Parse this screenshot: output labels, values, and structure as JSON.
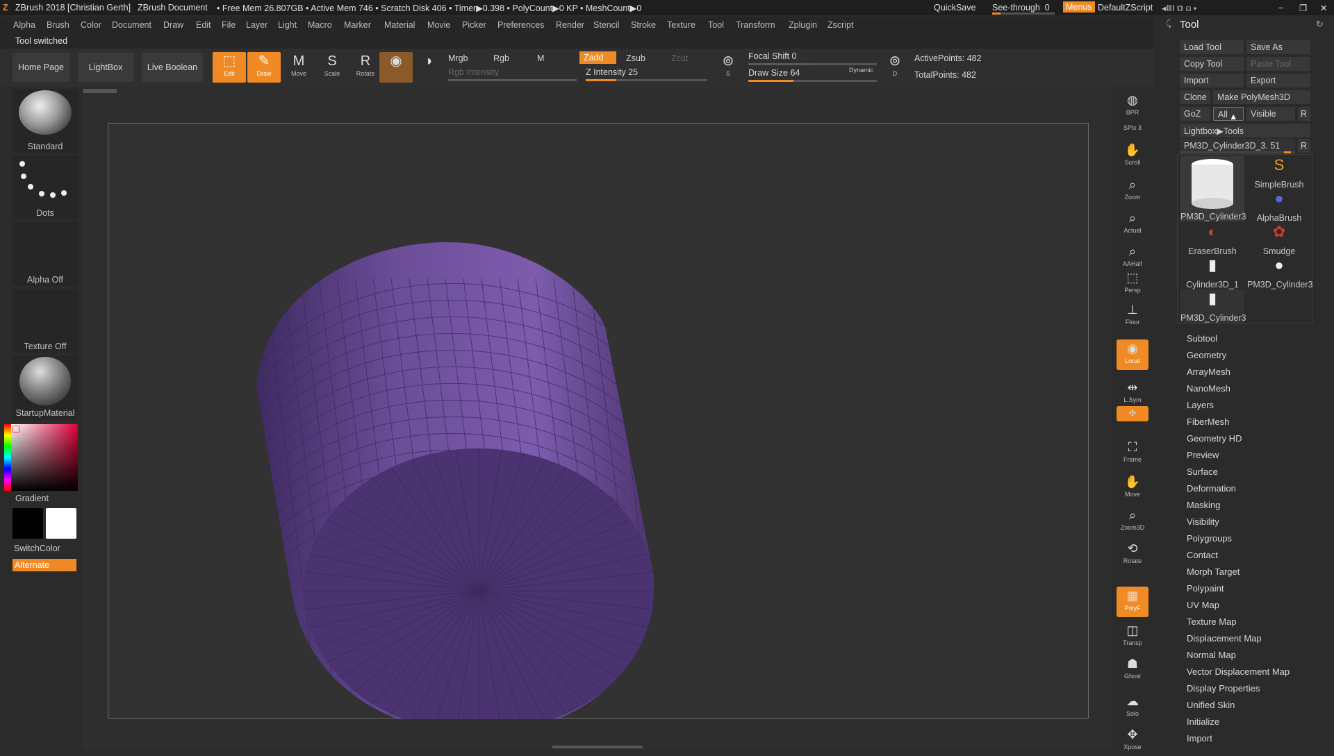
{
  "titlebar": {
    "app": "ZBrush 2018 [Christian Gerth]",
    "document": "ZBrush Document",
    "stats": "• Free Mem 26.807GB • Active Mem 746 • Scratch Disk 406 • Timer▶0.398 • PolyCount▶0 KP • MeshCount▶0",
    "quicksave": "QuickSave",
    "see_through": "See-through",
    "see_through_value": "0",
    "menus": "Menus",
    "script": "DefaultZScript"
  },
  "menubar": [
    "Alpha",
    "Brush",
    "Color",
    "Document",
    "Draw",
    "Edit",
    "File",
    "Layer",
    "Light",
    "Macro",
    "Marker",
    "Material",
    "Movie",
    "Picker",
    "Preferences",
    "Render",
    "Stencil",
    "Stroke",
    "Texture",
    "Tool",
    "Transform",
    "Zplugin",
    "Zscript"
  ],
  "status_text": "Tool switched",
  "toolbar": {
    "home_page": "Home Page",
    "lightbox": "LightBox",
    "live_boolean": "Live Boolean",
    "edit": "Edit",
    "draw": "Draw",
    "move": "Move",
    "scale": "Scale",
    "rotate": "Rotate",
    "mrgb": "Mrgb",
    "rgb": "Rgb",
    "m": "M",
    "zadd": "Zadd",
    "zsub": "Zsub",
    "zcut": "Zcut",
    "rgb_intensity": "Rgb Intensity",
    "z_intensity_label": "Z Intensity",
    "z_intensity": 25,
    "focal_shift_label": "Focal Shift",
    "focal_shift": 0,
    "draw_size_label": "Draw Size",
    "draw_size": 64,
    "dynamic": "Dynamic",
    "active_points": "ActivePoints: 482",
    "total_points": "TotalPoints: 482"
  },
  "left_shelf": {
    "brush": "Standard",
    "stroke": "Dots",
    "alpha": "Alpha Off",
    "texture": "Texture Off",
    "material": "StartupMaterial",
    "gradient": "Gradient",
    "switch_color": "SwitchColor",
    "alternate": "Alternate"
  },
  "right_shelf": [
    {
      "name": "bpr",
      "label": "BPR",
      "icon": "bpr-icon",
      "on": false
    },
    {
      "name": "spix",
      "label": "SPix 3",
      "icon": "",
      "on": false
    },
    {
      "name": "scroll",
      "label": "Scroll",
      "icon": "hand-icon",
      "on": false
    },
    {
      "name": "zoom",
      "label": "Zoom",
      "icon": "zoom-icon",
      "on": false
    },
    {
      "name": "actual",
      "label": "Actual",
      "icon": "zoom-icon",
      "on": false
    },
    {
      "name": "aahalf",
      "label": "AAHalf",
      "icon": "zoom-icon",
      "on": false
    },
    {
      "name": "persp",
      "label": "Persp",
      "icon": "persp-icon",
      "on": false
    },
    {
      "name": "floor",
      "label": "Floor",
      "icon": "floor-icon",
      "on": false
    },
    {
      "name": "local",
      "label": "Local",
      "icon": "local-icon",
      "on": true
    },
    {
      "name": "lsym",
      "label": "L.Sym",
      "icon": "sym-icon",
      "on": false
    },
    {
      "name": "xyz",
      "label": "xyz",
      "icon": "xyz-icon",
      "on": true
    },
    {
      "name": "frame",
      "label": "Frame",
      "icon": "frame-icon",
      "on": false
    },
    {
      "name": "move3d",
      "label": "Move",
      "icon": "hand-icon",
      "on": false
    },
    {
      "name": "zoom3d",
      "label": "Zoom3D",
      "icon": "zoom-icon",
      "on": false
    },
    {
      "name": "rotate3d",
      "label": "Rotate",
      "icon": "rotate-icon",
      "on": false
    },
    {
      "name": "polyf",
      "label": "PolyF",
      "icon": "grid-icon",
      "on": true
    },
    {
      "name": "transp",
      "label": "Transp",
      "icon": "transp-icon",
      "on": false
    },
    {
      "name": "ghost",
      "label": "Ghost",
      "icon": "ghost-icon",
      "on": false
    },
    {
      "name": "solo",
      "label": "Solo",
      "icon": "solo-icon",
      "on": false
    },
    {
      "name": "xpose",
      "label": "Xpose",
      "icon": "xpose-icon",
      "on": false
    }
  ],
  "tool_panel": {
    "title": "Tool",
    "load_tool": "Load Tool",
    "save_as": "Save As",
    "copy_tool": "Copy Tool",
    "paste_tool": "Paste Tool",
    "import": "Import",
    "export": "Export",
    "clone": "Clone",
    "make_polymesh": "Make PolyMesh3D",
    "goz": "GoZ",
    "all": "All",
    "visible": "Visible",
    "r": "R",
    "lightbox_tools": "Lightbox▶Tools",
    "current_tool": "PM3D_Cylinder3D_3. 51",
    "thumbs": [
      "PM3D_Cylinder3",
      "SimpleBrush",
      "AlphaBrush",
      "EraserBrush",
      "Smudge",
      "Cylinder3D_1",
      "PM3D_Cylinder3",
      "PM3D_Cylinder3"
    ],
    "sections": [
      "Subtool",
      "Geometry",
      "ArrayMesh",
      "NanoMesh",
      "Layers",
      "FiberMesh",
      "Geometry HD",
      "Preview",
      "Surface",
      "Deformation",
      "Masking",
      "Visibility",
      "Polygroups",
      "Contact",
      "Morph Target",
      "Polypaint",
      "UV Map",
      "Texture Map",
      "Displacement Map",
      "Normal Map",
      "Vector Displacement Map",
      "Display Properties",
      "Unified Skin",
      "Initialize",
      "Import"
    ]
  },
  "colors": {
    "accent": "#f08a24",
    "mesh": "#5b3f86"
  }
}
